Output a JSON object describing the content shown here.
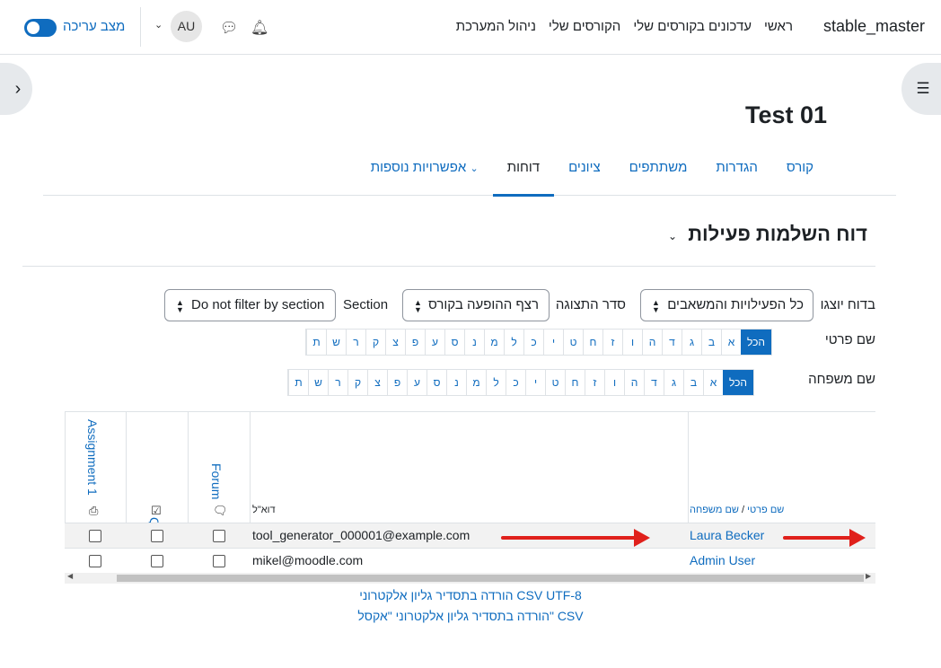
{
  "navbar": {
    "brand": "stable_master",
    "items": [
      "ראשי",
      "עדכונים בקורסים שלי",
      "הקורסים שלי",
      "ניהול המערכת"
    ],
    "avatar_initials": "AU",
    "edit_mode_label": "מצב עריכה",
    "edit_mode_on": true
  },
  "course": {
    "title": "Test 01",
    "tabs": [
      "קורס",
      "הגדרות",
      "משתתפים",
      "ציונים",
      "דוחות",
      "אפשרויות נוספות"
    ],
    "active_tab": "דוחות"
  },
  "report": {
    "title": "דוח השלמות פעילות",
    "filters": {
      "include_label": "בדוח יוצגו",
      "include_value": "כל הפעילויות והמשאבים",
      "order_label": "סדר התצוגה",
      "order_value": "רצף ההופעה בקורס",
      "section_label": "Section",
      "section_value": "Do not filter by section"
    },
    "firstname_label": "שם פרטי",
    "lastname_label": "שם משפחה",
    "alpha_all": "הכל",
    "letters": [
      "א",
      "ב",
      "ג",
      "ד",
      "ה",
      "ו",
      "ז",
      "ח",
      "ט",
      "י",
      "כ",
      "ל",
      "מ",
      "נ",
      "ס",
      "ע",
      "פ",
      "צ",
      "ק",
      "ר",
      "ש",
      "ת"
    ]
  },
  "table": {
    "name_header_first": "שם פרטי",
    "name_header_sep": "/",
    "name_header_last": "שם משפחה",
    "email_header": "דוא\"ל",
    "activities": [
      {
        "name": "Forum",
        "icon": "forum-icon"
      },
      {
        "name": "Quiz",
        "icon": "quiz-icon"
      },
      {
        "name": "Assignment 1",
        "icon": "assignment-icon"
      }
    ],
    "rows": [
      {
        "name": "Laura Becker",
        "email": "tool_generator_000001@example.com"
      },
      {
        "name": "Admin User",
        "email": "mikel@moodle.com"
      }
    ]
  },
  "downloads": {
    "csv_utf8": "הורדה בתסדיר גליון אלקטרוני CSV UTF-8",
    "csv_excel": "הורדה בתסדיר גליון אלקטרוני \"אקסל\" CSV"
  },
  "colors": {
    "link": "#0f6cbf",
    "annotation_arrow": "#e0201b"
  }
}
